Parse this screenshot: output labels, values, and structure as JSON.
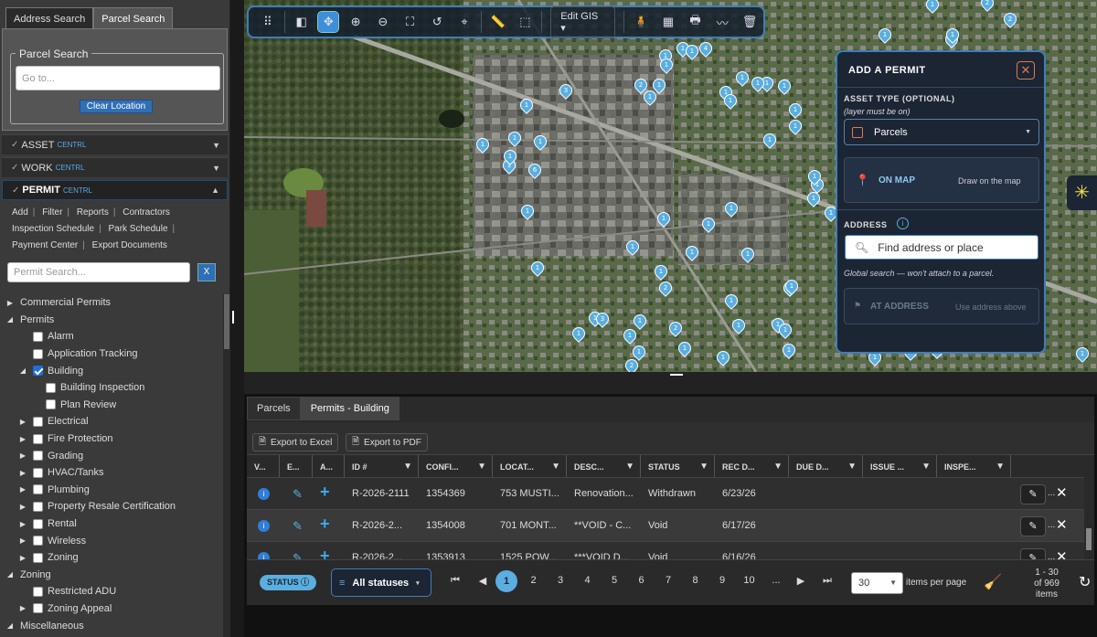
{
  "search_tabs": {
    "address": "Address Search",
    "parcel": "Parcel Search"
  },
  "parcel_search": {
    "legend": "Parcel Search",
    "placeholder": "Go to...",
    "clear_label": "Clear Location"
  },
  "accordion": [
    {
      "label": "ASSET",
      "sub": "CENTRL"
    },
    {
      "label": "WORK",
      "sub": "CENTRL"
    },
    {
      "label": "PERMIT",
      "sub": "CENTRL"
    }
  ],
  "permit_links": {
    "add": "Add",
    "filter": "Filter",
    "reports": "Reports",
    "contractors": "Contractors",
    "inspection_schedule": "Inspection Schedule",
    "park_schedule": "Park Schedule",
    "payment_center": "Payment Center",
    "export_documents": "Export Documents"
  },
  "permit_search": {
    "placeholder": "Permit Search...",
    "clear": "X"
  },
  "tree": [
    {
      "label": "Commercial Permits",
      "level": 0,
      "arrow": "▶",
      "checkbox": false,
      "checked": false
    },
    {
      "label": "Permits",
      "level": 0,
      "arrow": "◢",
      "checkbox": false,
      "checked": false
    },
    {
      "label": "Alarm",
      "level": 1,
      "arrow": "",
      "checkbox": true,
      "checked": false
    },
    {
      "label": "Application Tracking",
      "level": 1,
      "arrow": "",
      "checkbox": true,
      "checked": false
    },
    {
      "label": "Building",
      "level": 1,
      "arrow": "◢",
      "checkbox": true,
      "checked": true
    },
    {
      "label": "Building Inspection",
      "level": 2,
      "arrow": "",
      "checkbox": true,
      "checked": false
    },
    {
      "label": "Plan Review",
      "level": 2,
      "arrow": "",
      "checkbox": true,
      "checked": false
    },
    {
      "label": "Electrical",
      "level": 1,
      "arrow": "▶",
      "checkbox": true,
      "checked": false
    },
    {
      "label": "Fire Protection",
      "level": 1,
      "arrow": "▶",
      "checkbox": true,
      "checked": false
    },
    {
      "label": "Grading",
      "level": 1,
      "arrow": "▶",
      "checkbox": true,
      "checked": false
    },
    {
      "label": "HVAC/Tanks",
      "level": 1,
      "arrow": "▶",
      "checkbox": true,
      "checked": false
    },
    {
      "label": "Plumbing",
      "level": 1,
      "arrow": "▶",
      "checkbox": true,
      "checked": false
    },
    {
      "label": "Property Resale Certification",
      "level": 1,
      "arrow": "▶",
      "checkbox": true,
      "checked": false
    },
    {
      "label": "Rental",
      "level": 1,
      "arrow": "▶",
      "checkbox": true,
      "checked": false
    },
    {
      "label": "Wireless",
      "level": 1,
      "arrow": "▶",
      "checkbox": true,
      "checked": false
    },
    {
      "label": "Zoning",
      "level": 1,
      "arrow": "▶",
      "checkbox": true,
      "checked": false
    },
    {
      "label": "Zoning",
      "level": 0,
      "arrow": "◢",
      "checkbox": false,
      "checked": false
    },
    {
      "label": "Restricted ADU",
      "level": 1,
      "arrow": "",
      "checkbox": true,
      "checked": false
    },
    {
      "label": "Zoning Appeal",
      "level": 1,
      "arrow": "▶",
      "checkbox": true,
      "checked": false
    },
    {
      "label": "Miscellaneous",
      "level": 0,
      "arrow": "◢",
      "checkbox": false,
      "checked": false
    }
  ],
  "toolbar": {
    "edit_gis": "Edit GIS"
  },
  "map_markers": [
    "1",
    "2",
    "2",
    "1",
    "1",
    "1",
    "4",
    "1",
    "1",
    "1",
    "1",
    "1",
    "1",
    "1",
    "3",
    "1",
    "1",
    "1",
    "1",
    "1",
    "1",
    "1",
    "1",
    "1",
    "6",
    "1",
    "1",
    "1",
    "1",
    "1",
    "1",
    "1",
    "1",
    "1",
    "1",
    "1",
    "1",
    "2",
    "1",
    "1",
    "1",
    "1",
    "1",
    "3",
    "1",
    "2",
    "1",
    "1",
    "1",
    "1",
    "1",
    "1",
    "2",
    "1",
    "1",
    "1",
    "1",
    "1",
    "1",
    "2",
    "1",
    "1",
    "1",
    "1",
    "1",
    "1"
  ],
  "add_permit": {
    "title": "ADD A PERMIT",
    "asset_type_label": "ASSET TYPE (OPTIONAL)",
    "asset_type_note": "(layer must be on)",
    "asset_type_value": "Parcels",
    "on_map_label": "ON MAP",
    "on_map_hint": "Draw on the map",
    "address_label": "ADDRESS",
    "address_placeholder": "Find address or place",
    "global_note": "Global search — won't attach to a parcel.",
    "at_address_label": "AT ADDRESS",
    "at_address_hint": "Use address above"
  },
  "grid_tabs": {
    "parcels": "Parcels",
    "permits_building": "Permits - Building"
  },
  "grid_toolbar": {
    "export_excel": "Export to Excel",
    "export_pdf": "Export to PDF"
  },
  "grid_columns": [
    "V...",
    "E...",
    "A...",
    "ID #",
    "CONFI...",
    "LOCAT...",
    "DESC...",
    "STATUS",
    "REC D...",
    "DUE D...",
    "ISSUE ...",
    "INSPE..."
  ],
  "grid_rows": [
    {
      "id": "R-2026-2111",
      "confirmation": "1354369",
      "location": "753 MUSTI...",
      "description": "Renovation...",
      "status": "Withdrawn",
      "rec_date": "6/23/26"
    },
    {
      "id": "R-2026-2...",
      "confirmation": "1354008",
      "location": "701 MONT...",
      "description": "**VOID - C...",
      "status": "Void",
      "rec_date": "6/17/26"
    },
    {
      "id": "R-2026-2...",
      "confirmation": "1353913",
      "location": "1525 POW...",
      "description": "***VOID D...",
      "status": "Void",
      "rec_date": "6/16/26"
    }
  ],
  "pager": {
    "status_label": "STATUS",
    "status_filter": "All statuses",
    "pages": [
      "1",
      "2",
      "3",
      "4",
      "5",
      "6",
      "7",
      "8",
      "9",
      "10",
      "..."
    ],
    "current_page": "1",
    "per_page": "30",
    "per_page_label": "items per page",
    "range": "1 - 30",
    "of_items": "of 969",
    "items_word": "items"
  }
}
